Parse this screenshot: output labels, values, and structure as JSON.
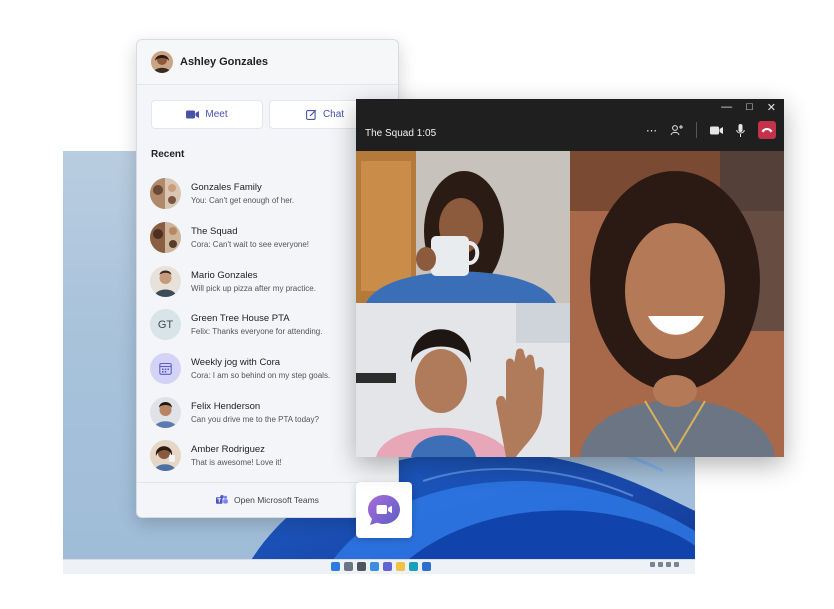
{
  "user": {
    "name": "Ashley Gonzales"
  },
  "actions": {
    "meet_label": "Meet",
    "chat_label": "Chat"
  },
  "recent": {
    "title": "Recent",
    "items": [
      {
        "name": "Gonzales Family",
        "preview": "You: Can't get enough of her.",
        "avatar": "group-photo"
      },
      {
        "name": "The Squad",
        "preview": "Cora: Can't wait to see everyone!",
        "avatar": "group-photo"
      },
      {
        "name": "Mario Gonzales",
        "preview": "Will pick up pizza after my practice.",
        "avatar": "person-photo"
      },
      {
        "name": "Green Tree House PTA",
        "preview": "Felix: Thanks everyone for attending.",
        "avatar": "initials",
        "initials": "GT"
      },
      {
        "name": "Weekly jog with Cora",
        "preview": "Cora: I am so behind on my step goals.",
        "avatar": "calendar-icon"
      },
      {
        "name": "Felix Henderson",
        "preview": "Can you drive me to the PTA today?",
        "avatar": "person-photo"
      },
      {
        "name": "Amber Rodriguez",
        "preview": "That is awesome! Love it!",
        "avatar": "person-photo"
      }
    ]
  },
  "footer": {
    "open_label": "Open Microsoft Teams"
  },
  "call": {
    "title": "The Squad 1:05"
  },
  "colors": {
    "accent": "#5b5fc7",
    "hangup": "#c4314b",
    "call_bg": "#1f1f1f",
    "panel_bg": "#f3f5f8"
  }
}
